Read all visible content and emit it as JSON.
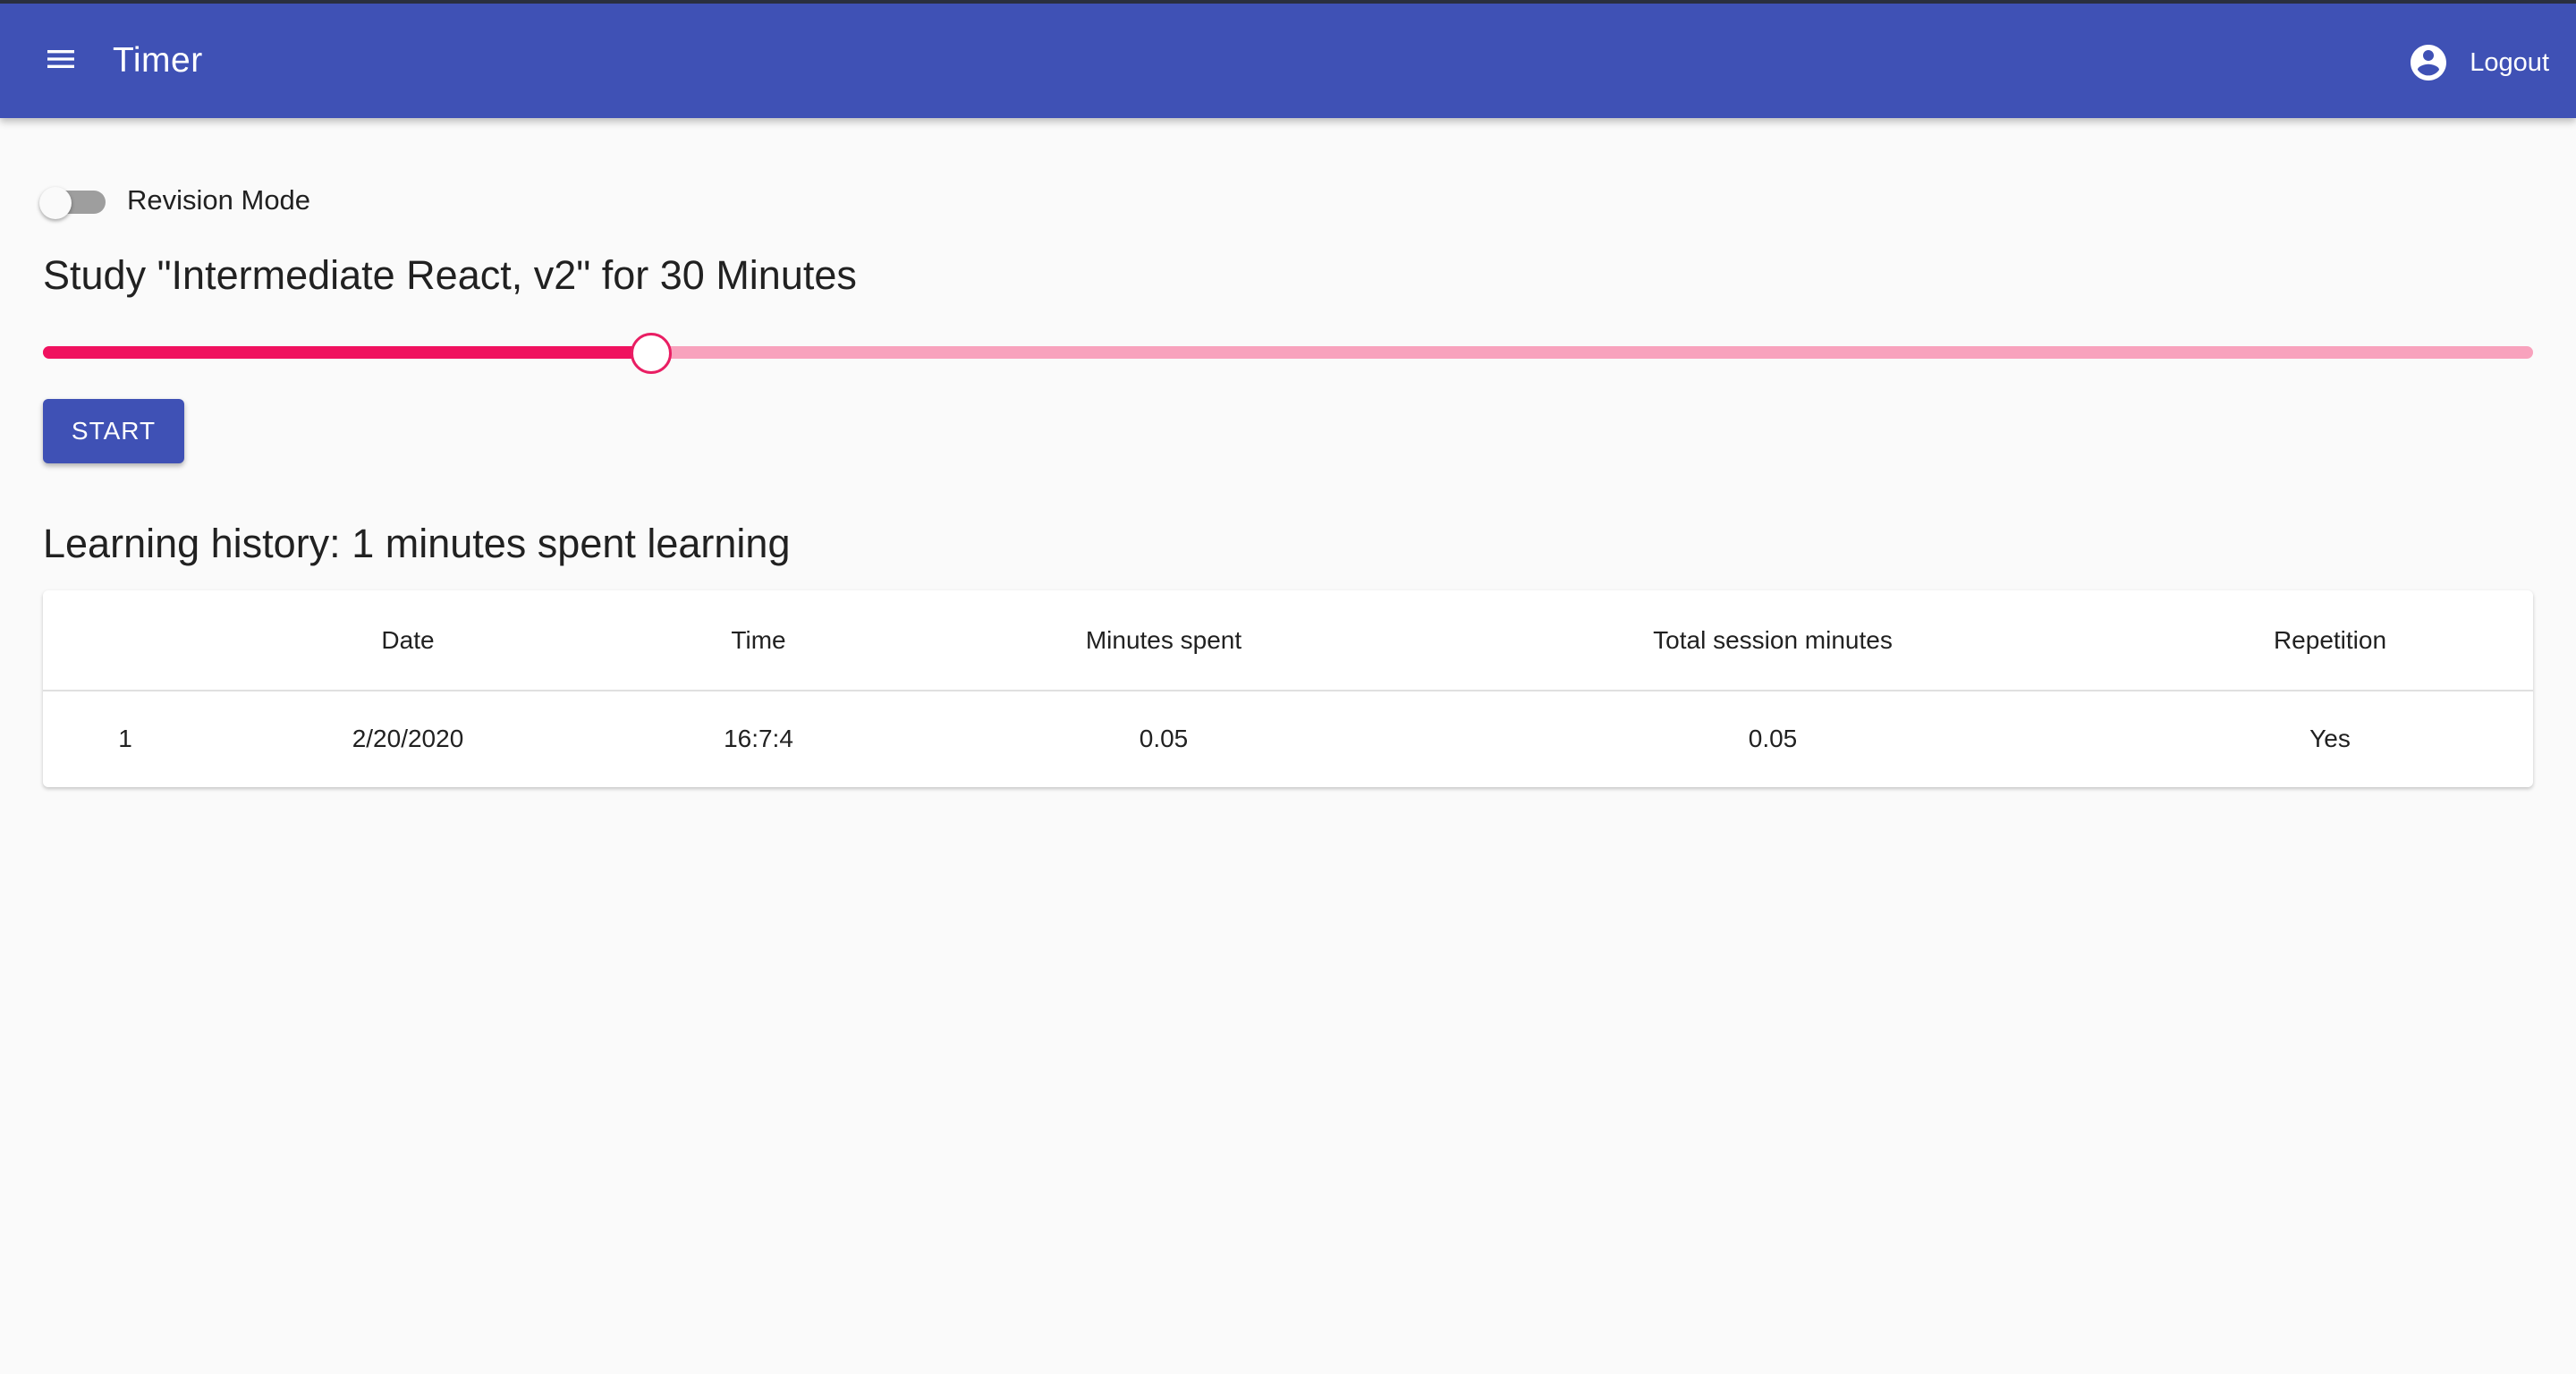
{
  "app_bar": {
    "title": "Timer",
    "menu_icon": "menu-icon",
    "account_icon": "account-circle-icon",
    "logout_label": "Logout",
    "background_color": "#3f51b5"
  },
  "revision_mode": {
    "label": "Revision Mode",
    "checked": false
  },
  "study": {
    "title": "Study \"Intermediate React, v2\" for 30 Minutes",
    "slider_value_fraction": 0.244,
    "slider_color": "#e91e63"
  },
  "start_button": {
    "label": "START"
  },
  "history": {
    "title": "Learning history: 1 minutes spent learning",
    "columns": [
      "",
      "Date",
      "Time",
      "Minutes spent",
      "Total session minutes",
      "Repetition"
    ],
    "rows": [
      [
        "1",
        "2/20/2020",
        "16:7:4",
        "0.05",
        "0.05",
        "Yes"
      ]
    ]
  }
}
